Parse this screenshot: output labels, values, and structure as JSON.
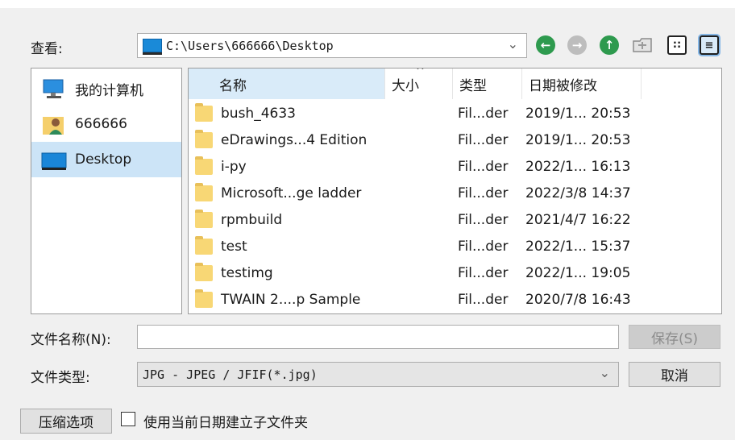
{
  "look_in": {
    "label": "查看:",
    "path": "C:\\Users\\666666\\Desktop"
  },
  "toolbar": {
    "back_icon": "back-arrow-icon",
    "forward_icon": "forward-arrow-icon",
    "up_icon": "up-arrow-icon",
    "new_folder_icon": "new-folder-icon",
    "list_view_icon": "list-view-icon",
    "detail_view_icon": "detail-view-icon"
  },
  "places": [
    {
      "label": "我的计算机",
      "icon": "computer-icon"
    },
    {
      "label": "666666",
      "icon": "user-folder-icon"
    },
    {
      "label": "Desktop",
      "icon": "desktop-icon",
      "selected": true
    }
  ],
  "columns": [
    "名称",
    "大小",
    "类型",
    "日期被修改"
  ],
  "files": [
    {
      "name": "bush_4633",
      "type": "Fil...der",
      "date": "2019/1... 20:53"
    },
    {
      "name": "eDrawings...4 Edition",
      "type": "Fil...der",
      "date": "2019/1... 20:53"
    },
    {
      "name": "i-py",
      "type": "Fil...der",
      "date": "2022/1... 16:13"
    },
    {
      "name": "Microsoft...ge ladder",
      "type": "Fil...der",
      "date": "2022/3/8 14:37"
    },
    {
      "name": "rpmbuild",
      "type": "Fil...der",
      "date": "2021/4/7 16:22"
    },
    {
      "name": "test",
      "type": "Fil...der",
      "date": "2022/1... 15:37"
    },
    {
      "name": "testimg",
      "type": "Fil...der",
      "date": "2022/1... 19:05"
    },
    {
      "name": "TWAIN 2....p Sample",
      "type": "Fil...der",
      "date": "2020/7/8 16:43"
    }
  ],
  "filename": {
    "label": "文件名称(N):",
    "value": ""
  },
  "filetype": {
    "label": "文件类型:",
    "value": "JPG - JPEG / JFIF(*.jpg)"
  },
  "buttons": {
    "save": "保存(S)",
    "cancel": "取消",
    "compress": "压缩选项"
  },
  "subfolder_option": {
    "label": "使用当前日期建立子文件夹",
    "checked": false
  }
}
